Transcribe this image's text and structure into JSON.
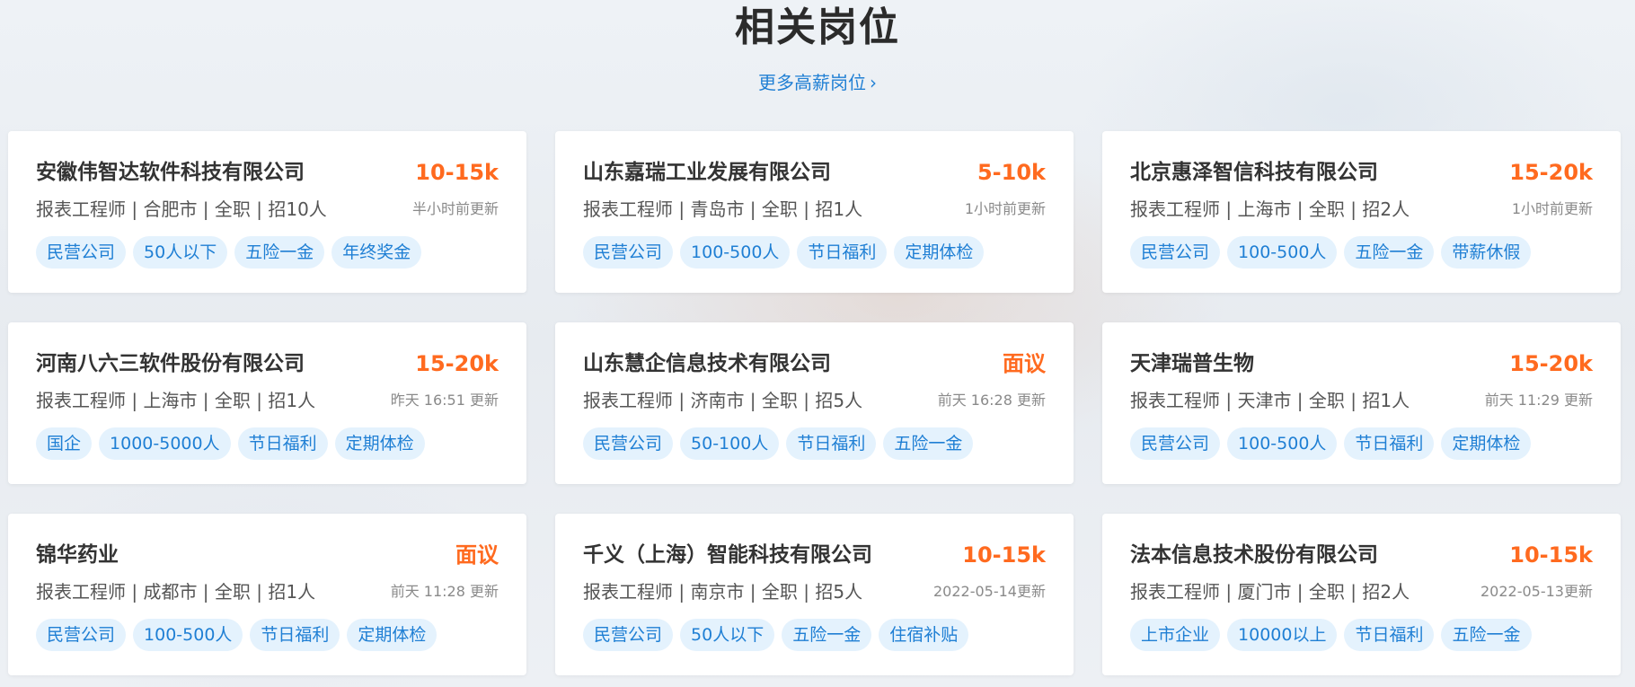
{
  "header": {
    "title": "相关岗位",
    "more_label": "更多高薪岗位",
    "more_chevron": "›"
  },
  "jobs": [
    {
      "company": "安徽伟智达软件科技有限公司",
      "salary": "10-15k",
      "meta": "报表工程师 | 合肥市 | 全职 | 招10人",
      "updated": "半小时前更新",
      "tags": [
        "民营公司",
        "50人以下",
        "五险一金",
        "年终奖金"
      ]
    },
    {
      "company": "山东嘉瑞工业发展有限公司",
      "salary": "5-10k",
      "meta": "报表工程师 | 青岛市 | 全职 | 招1人",
      "updated": "1小时前更新",
      "tags": [
        "民营公司",
        "100-500人",
        "节日福利",
        "定期体检"
      ]
    },
    {
      "company": "北京惠泽智信科技有限公司",
      "salary": "15-20k",
      "meta": "报表工程师 | 上海市 | 全职 | 招2人",
      "updated": "1小时前更新",
      "tags": [
        "民营公司",
        "100-500人",
        "五险一金",
        "带薪休假"
      ]
    },
    {
      "company": "河南八六三软件股份有限公司",
      "salary": "15-20k",
      "meta": "报表工程师 | 上海市 | 全职 | 招1人",
      "updated": "昨天 16:51 更新",
      "tags": [
        "国企",
        "1000-5000人",
        "节日福利",
        "定期体检"
      ]
    },
    {
      "company": "山东慧企信息技术有限公司",
      "salary": "面议",
      "meta": "报表工程师 | 济南市 | 全职 | 招5人",
      "updated": "前天 16:28 更新",
      "tags": [
        "民营公司",
        "50-100人",
        "节日福利",
        "五险一金"
      ]
    },
    {
      "company": "天津瑞普生物",
      "salary": "15-20k",
      "meta": "报表工程师 | 天津市 | 全职 | 招1人",
      "updated": "前天 11:29 更新",
      "tags": [
        "民营公司",
        "100-500人",
        "节日福利",
        "定期体检"
      ]
    },
    {
      "company": "锦华药业",
      "salary": "面议",
      "meta": "报表工程师 | 成都市 | 全职 | 招1人",
      "updated": "前天 11:28 更新",
      "tags": [
        "民营公司",
        "100-500人",
        "节日福利",
        "定期体检"
      ]
    },
    {
      "company": "千义（上海）智能科技有限公司",
      "salary": "10-15k",
      "meta": "报表工程师 | 南京市 | 全职 | 招5人",
      "updated": "2022-05-14更新",
      "tags": [
        "民营公司",
        "50人以下",
        "五险一金",
        "住宿补贴"
      ]
    },
    {
      "company": "法本信息技术股份有限公司",
      "salary": "10-15k",
      "meta": "报表工程师 | 厦门市 | 全职 | 招2人",
      "updated": "2022-05-13更新",
      "tags": [
        "上市企业",
        "10000以上",
        "节日福利",
        "五险一金"
      ]
    }
  ],
  "colors": {
    "salary": "#ff6a1f",
    "link": "#1f7fd4",
    "tag_bg": "#e4f2fd",
    "tag_text": "#1f7fd4"
  }
}
